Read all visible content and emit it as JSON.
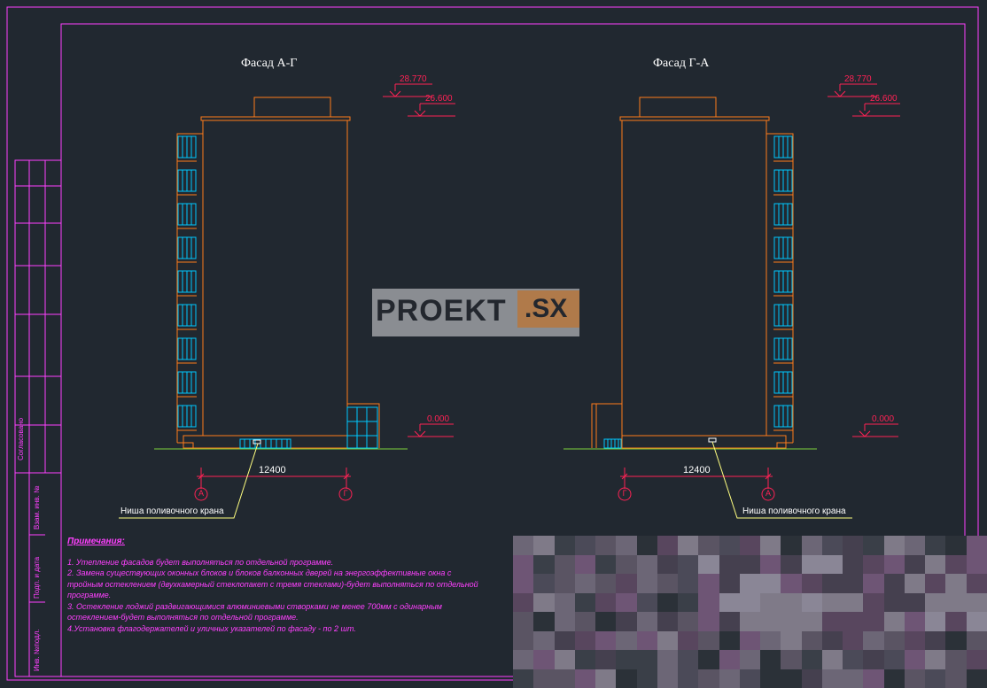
{
  "left_facade": {
    "title": "Фасад А-Г",
    "level_top": "28.770",
    "level_roof": "26.600",
    "level_ground": "0.000",
    "dimension": "12400",
    "axis_left": "А",
    "axis_right": "Г",
    "callout": "Ниша поливочного крана"
  },
  "right_facade": {
    "title": "Фасад Г-А",
    "level_top": "28.770",
    "level_roof": "26.600",
    "level_ground": "0.000",
    "dimension": "12400",
    "axis_left": "Г",
    "axis_right": "А",
    "callout": "Ниша поливочного крана"
  },
  "notes": {
    "title": "Примечания:",
    "items": [
      "1. Утепление фасадов будет выполняться по отдельной программе.",
      "2. Замена существующих оконных блоков и блоков балконных дверей на энергоэффективные окна с тройным остеклением (двухкамерный стеклопакет с тремя стеклами)-будет выполняться по отдельной программе.",
      "3. Остекление лоджий раздвигающимися алюминиевыми створками не менее 700мм с одинарным остеклением-будет выполняться по отдельной программе.",
      "4.Установка флагодержателей и уличных указателей по фасаду - по 2 шт."
    ]
  },
  "side_stamp": {
    "agreed": "Согласовано",
    "inv_vzam": "Взам. инв. №",
    "sign_date": "Подп. и дата",
    "inv_podl": "Инв. №подл."
  },
  "watermark": {
    "main": "PROEKT",
    "ext": ".SX"
  },
  "colors": {
    "background": "#212830",
    "frame": "#ff40ff",
    "building": "#ff7b1a",
    "glazing": "#00c8ff",
    "level_marks": "#ff2255",
    "ground": "#7dd23c",
    "dimension": "#ff2255"
  }
}
